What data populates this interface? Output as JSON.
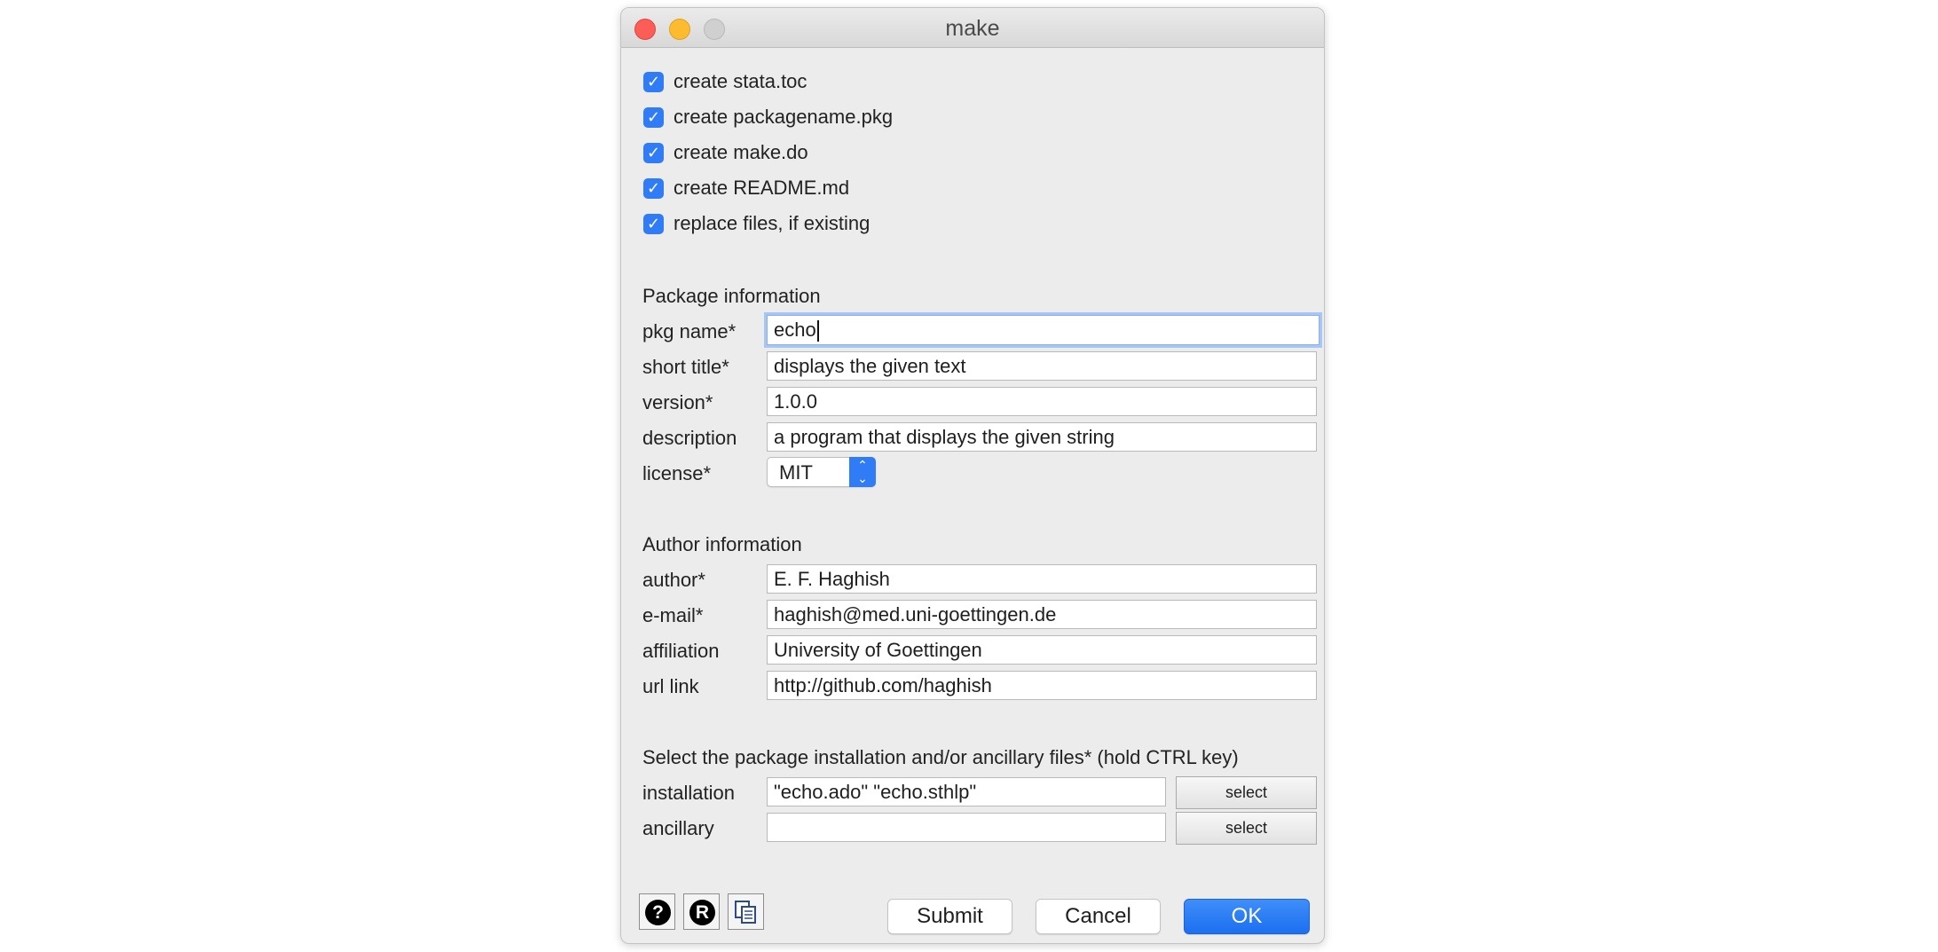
{
  "window": {
    "title": "make"
  },
  "options": [
    {
      "label": "create stata.toc",
      "checked": true
    },
    {
      "label": "create packagename.pkg",
      "checked": true
    },
    {
      "label": "create make.do",
      "checked": true
    },
    {
      "label": "create README.md",
      "checked": true
    },
    {
      "label": "replace files, if existing",
      "checked": true
    }
  ],
  "package": {
    "heading": "Package information",
    "pkg_name_label": "pkg name*",
    "pkg_name": "echo",
    "short_title_label": "short title*",
    "short_title": "displays the given text",
    "version_label": "version*",
    "version": "1.0.0",
    "description_label": "description",
    "description": "a program that displays the given string",
    "license_label": "license*",
    "license": "MIT"
  },
  "author": {
    "heading": "Author information",
    "author_label": "author*",
    "author": "E. F. Haghish",
    "email_label": "e-mail*",
    "email": "haghish@med.uni-goettingen.de",
    "affiliation_label": "affiliation",
    "affiliation": "University of Goettingen",
    "url_label": "url link",
    "url": "http://github.com/haghish"
  },
  "files": {
    "heading": "Select the package installation and/or ancillary files*  (hold CTRL key)",
    "installation_label": "installation",
    "installation": "\"echo.ado\" \"echo.sthlp\"",
    "ancillary_label": "ancillary",
    "ancillary": "",
    "select_label": "select"
  },
  "buttons": {
    "submit": "Submit",
    "cancel": "Cancel",
    "ok": "OK"
  },
  "icons": {
    "help": "?",
    "r": "R"
  },
  "colors": {
    "accent": "#2f7cf6",
    "close": "#fc5d56",
    "minimize": "#fdbb2f"
  }
}
